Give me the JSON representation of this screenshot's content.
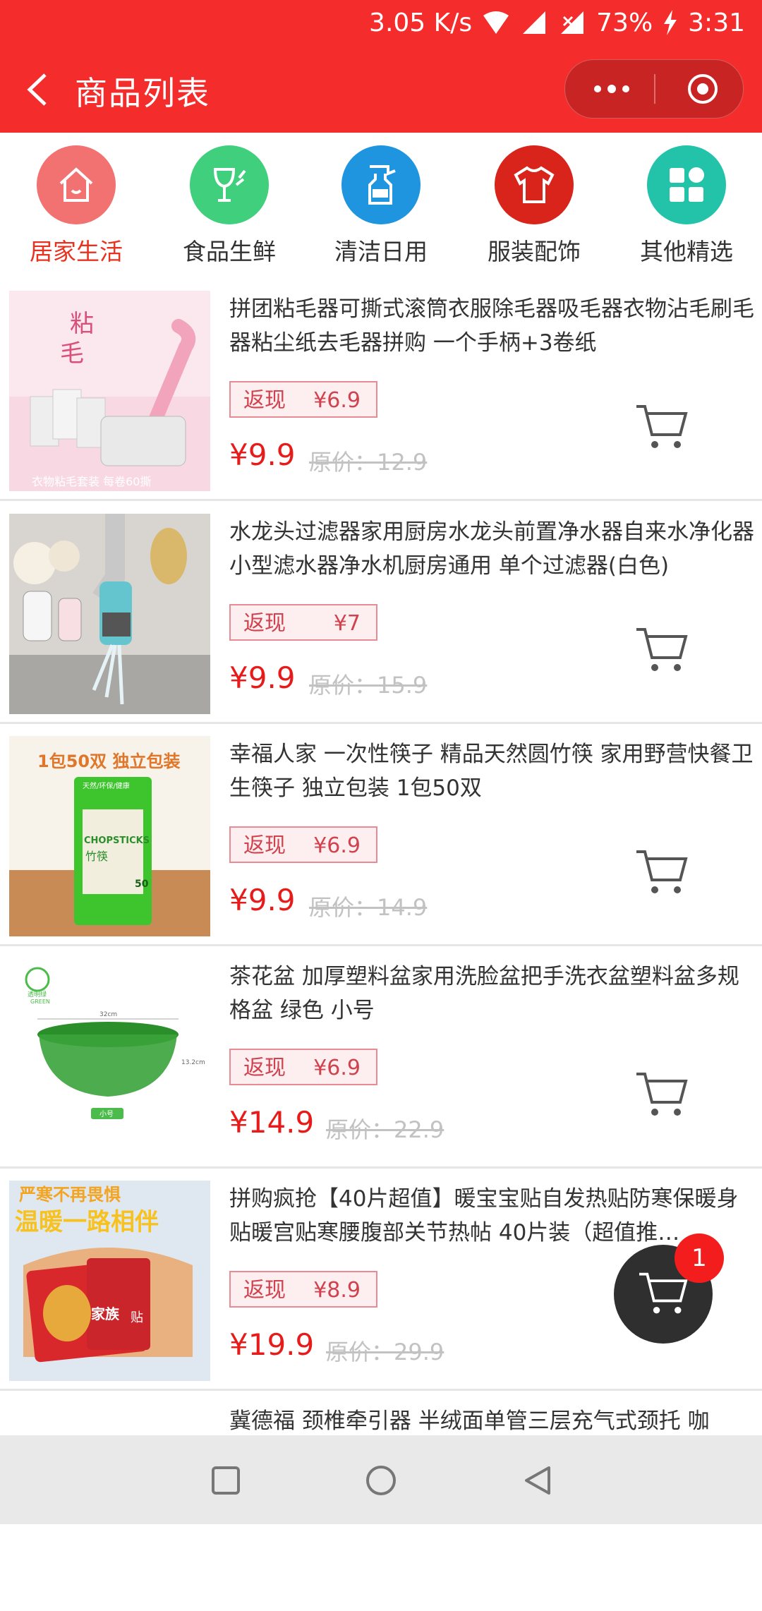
{
  "status": {
    "speed": "3.05 K/s",
    "battery": "73%",
    "time": "3:31"
  },
  "header": {
    "title": "商品列表"
  },
  "categories": [
    {
      "label": "居家生活",
      "icon": "home-icon",
      "color": "#f27171"
    },
    {
      "label": "食品生鲜",
      "icon": "wine-glass-icon",
      "color": "#3fcf7d"
    },
    {
      "label": "清洁日用",
      "icon": "spray-bottle-icon",
      "color": "#1e95de"
    },
    {
      "label": "服装配饰",
      "icon": "tshirt-icon",
      "color": "#d9241c"
    },
    {
      "label": "其他精选",
      "icon": "grid-apps-icon",
      "color": "#22c3a8"
    }
  ],
  "products": [
    {
      "name": "拼团粘毛器可撕式滚筒衣服除毛器吸毛器衣物沾毛刷毛器粘尘纸去毛器拼购 一个手柄+3卷纸",
      "cashback_label": "返现",
      "cashback": "¥6.9",
      "price": "¥9.9",
      "original": "原价：12.9",
      "thumb_text": [
        "粘",
        "毛",
        "衣物粘毛套装  每卷60撕"
      ]
    },
    {
      "name": "水龙头过滤器家用厨房水龙头前置净水器自来水净化器小型滤水器净水机厨房通用 单个过滤器(白色)",
      "cashback_label": "返现",
      "cashback": "¥7",
      "price": "¥9.9",
      "original": "原价：15.9",
      "thumb_text": []
    },
    {
      "name": "幸福人家 一次性筷子 精品天然圆竹筷 家用野营快餐卫生筷子 独立包装 1包50双",
      "cashback_label": "返现",
      "cashback": "¥6.9",
      "price": "¥9.9",
      "original": "原价：14.9",
      "thumb_text": [
        "1包50双 独立包装",
        "天然/环保/健康",
        "CHOPSTICKS",
        "竹筷",
        "50"
      ]
    },
    {
      "name": "茶花盆 加厚塑料盆家用洗脸盆把手洗衣盆塑料盆多规格盆 绿色 小号",
      "cashback_label": "返现",
      "cashback": "¥6.9",
      "price": "¥14.9",
      "original": "原价：22.9",
      "thumb_text": [
        "透明绿",
        "GREEN",
        "32cm",
        "13.2cm",
        "小号"
      ]
    },
    {
      "name": "拼购疯抢【40片超值】暖宝宝贴自发热贴防寒保暖身贴暖宫贴寒腰腹部关节热帖 40片装（超值推…",
      "cashback_label": "返现",
      "cashback": "¥8.9",
      "price": "¥19.9",
      "original": "原价：29.9",
      "thumb_text": [
        "严寒不再畏惧",
        "温暖一路相伴",
        "家族",
        "贴"
      ]
    },
    {
      "name": "冀德福 颈椎牵引器 半绒面单管三层充气式颈托 咖",
      "cashback_label": "",
      "cashback": "",
      "price": "",
      "original": "",
      "thumb_text": []
    }
  ],
  "cart_badge": "1"
}
